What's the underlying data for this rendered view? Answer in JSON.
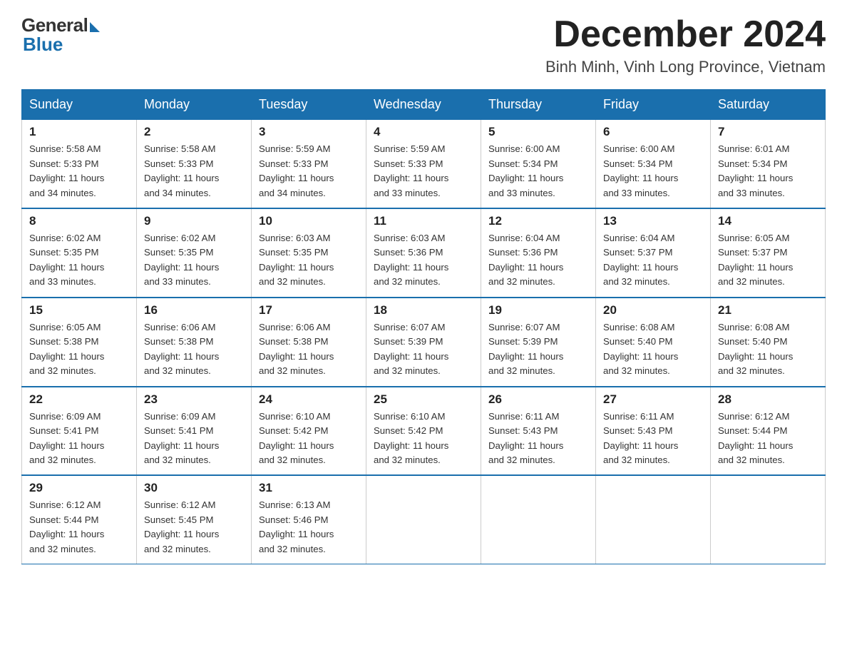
{
  "logo": {
    "general": "General",
    "blue": "Blue"
  },
  "header": {
    "month_year": "December 2024",
    "location": "Binh Minh, Vinh Long Province, Vietnam"
  },
  "days_of_week": [
    "Sunday",
    "Monday",
    "Tuesday",
    "Wednesday",
    "Thursday",
    "Friday",
    "Saturday"
  ],
  "weeks": [
    [
      {
        "day": "1",
        "sunrise": "5:58 AM",
        "sunset": "5:33 PM",
        "daylight": "11 hours and 34 minutes."
      },
      {
        "day": "2",
        "sunrise": "5:58 AM",
        "sunset": "5:33 PM",
        "daylight": "11 hours and 34 minutes."
      },
      {
        "day": "3",
        "sunrise": "5:59 AM",
        "sunset": "5:33 PM",
        "daylight": "11 hours and 34 minutes."
      },
      {
        "day": "4",
        "sunrise": "5:59 AM",
        "sunset": "5:33 PM",
        "daylight": "11 hours and 33 minutes."
      },
      {
        "day": "5",
        "sunrise": "6:00 AM",
        "sunset": "5:34 PM",
        "daylight": "11 hours and 33 minutes."
      },
      {
        "day": "6",
        "sunrise": "6:00 AM",
        "sunset": "5:34 PM",
        "daylight": "11 hours and 33 minutes."
      },
      {
        "day": "7",
        "sunrise": "6:01 AM",
        "sunset": "5:34 PM",
        "daylight": "11 hours and 33 minutes."
      }
    ],
    [
      {
        "day": "8",
        "sunrise": "6:02 AM",
        "sunset": "5:35 PM",
        "daylight": "11 hours and 33 minutes."
      },
      {
        "day": "9",
        "sunrise": "6:02 AM",
        "sunset": "5:35 PM",
        "daylight": "11 hours and 33 minutes."
      },
      {
        "day": "10",
        "sunrise": "6:03 AM",
        "sunset": "5:35 PM",
        "daylight": "11 hours and 32 minutes."
      },
      {
        "day": "11",
        "sunrise": "6:03 AM",
        "sunset": "5:36 PM",
        "daylight": "11 hours and 32 minutes."
      },
      {
        "day": "12",
        "sunrise": "6:04 AM",
        "sunset": "5:36 PM",
        "daylight": "11 hours and 32 minutes."
      },
      {
        "day": "13",
        "sunrise": "6:04 AM",
        "sunset": "5:37 PM",
        "daylight": "11 hours and 32 minutes."
      },
      {
        "day": "14",
        "sunrise": "6:05 AM",
        "sunset": "5:37 PM",
        "daylight": "11 hours and 32 minutes."
      }
    ],
    [
      {
        "day": "15",
        "sunrise": "6:05 AM",
        "sunset": "5:38 PM",
        "daylight": "11 hours and 32 minutes."
      },
      {
        "day": "16",
        "sunrise": "6:06 AM",
        "sunset": "5:38 PM",
        "daylight": "11 hours and 32 minutes."
      },
      {
        "day": "17",
        "sunrise": "6:06 AM",
        "sunset": "5:38 PM",
        "daylight": "11 hours and 32 minutes."
      },
      {
        "day": "18",
        "sunrise": "6:07 AM",
        "sunset": "5:39 PM",
        "daylight": "11 hours and 32 minutes."
      },
      {
        "day": "19",
        "sunrise": "6:07 AM",
        "sunset": "5:39 PM",
        "daylight": "11 hours and 32 minutes."
      },
      {
        "day": "20",
        "sunrise": "6:08 AM",
        "sunset": "5:40 PM",
        "daylight": "11 hours and 32 minutes."
      },
      {
        "day": "21",
        "sunrise": "6:08 AM",
        "sunset": "5:40 PM",
        "daylight": "11 hours and 32 minutes."
      }
    ],
    [
      {
        "day": "22",
        "sunrise": "6:09 AM",
        "sunset": "5:41 PM",
        "daylight": "11 hours and 32 minutes."
      },
      {
        "day": "23",
        "sunrise": "6:09 AM",
        "sunset": "5:41 PM",
        "daylight": "11 hours and 32 minutes."
      },
      {
        "day": "24",
        "sunrise": "6:10 AM",
        "sunset": "5:42 PM",
        "daylight": "11 hours and 32 minutes."
      },
      {
        "day": "25",
        "sunrise": "6:10 AM",
        "sunset": "5:42 PM",
        "daylight": "11 hours and 32 minutes."
      },
      {
        "day": "26",
        "sunrise": "6:11 AM",
        "sunset": "5:43 PM",
        "daylight": "11 hours and 32 minutes."
      },
      {
        "day": "27",
        "sunrise": "6:11 AM",
        "sunset": "5:43 PM",
        "daylight": "11 hours and 32 minutes."
      },
      {
        "day": "28",
        "sunrise": "6:12 AM",
        "sunset": "5:44 PM",
        "daylight": "11 hours and 32 minutes."
      }
    ],
    [
      {
        "day": "29",
        "sunrise": "6:12 AM",
        "sunset": "5:44 PM",
        "daylight": "11 hours and 32 minutes."
      },
      {
        "day": "30",
        "sunrise": "6:12 AM",
        "sunset": "5:45 PM",
        "daylight": "11 hours and 32 minutes."
      },
      {
        "day": "31",
        "sunrise": "6:13 AM",
        "sunset": "5:46 PM",
        "daylight": "11 hours and 32 minutes."
      },
      null,
      null,
      null,
      null
    ]
  ],
  "labels": {
    "sunrise": "Sunrise:",
    "sunset": "Sunset:",
    "daylight": "Daylight:"
  }
}
